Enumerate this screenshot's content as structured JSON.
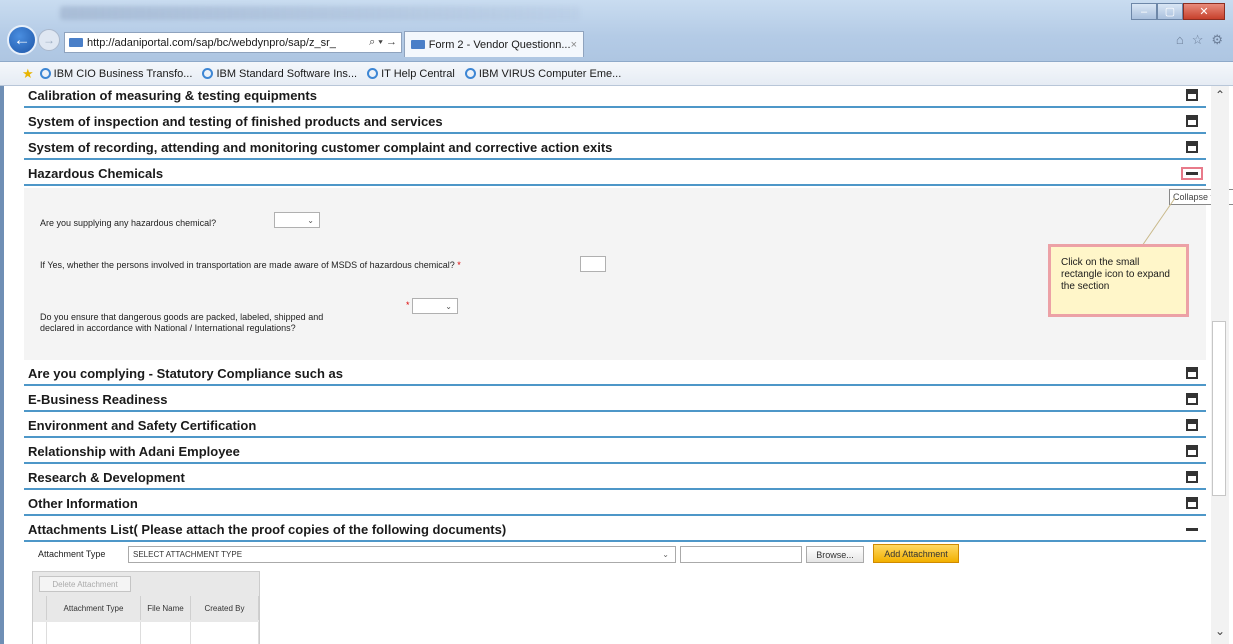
{
  "browser": {
    "address": "http://adaniportal.com/sap/bc/webdynpro/sap/z_sr_",
    "address_tools": "⌕ ▾ →",
    "tab_title": "Form 2 - Vendor Questionn...",
    "tab_close": "×",
    "right_icons": [
      "⌂",
      "☆",
      "⚙"
    ],
    "window_controls": [
      "–",
      "▢",
      "✕"
    ]
  },
  "favorites": [
    "IBM CIO Business Transfo...",
    "IBM Standard Software Ins...",
    "IT Help Central",
    "IBM VIRUS Computer Eme..."
  ],
  "sections": {
    "s1": "Calibration of measuring & testing equipments",
    "s2": "System of inspection and testing of finished products and services",
    "s3": "System of recording, attending and monitoring customer complaint and corrective action exits",
    "s4": "Hazardous Chemicals",
    "s5": "Are you complying - Statutory Compliance such as",
    "s6": "E-Business Readiness",
    "s7": "Environment and Safety Certification",
    "s8": "Relationship with Adani Employee",
    "s9": "Research & Development",
    "s10": "Other Information",
    "s11": "Attachments List( Please attach the proof copies of the following documents)"
  },
  "hazardous": {
    "q1": "Are you supplying any hazardous chemical?",
    "q2": "If Yes, whether the persons involved in transportation are made aware of MSDS of hazardous chemical?",
    "q3_line1": "Do you ensure that dangerous goods are packed, labeled, shipped and",
    "q3_line2": "declared in accordance with National / International regulations?",
    "required_mark": "*",
    "dropdown_chevron": "⌄"
  },
  "tooltip": "Collapse tray",
  "callout": "Click on the small rectangle icon to expand the section",
  "attachments": {
    "type_label": "Attachment Type",
    "type_select": "SELECT ATTACHMENT TYPE",
    "browse": "Browse...",
    "add": "Add Attachment",
    "delete": "Delete Attachment",
    "columns": [
      "Attachment Type",
      "File Name",
      "Created By"
    ]
  },
  "scrollbar": {
    "up": "⌃",
    "down": "⌄"
  }
}
